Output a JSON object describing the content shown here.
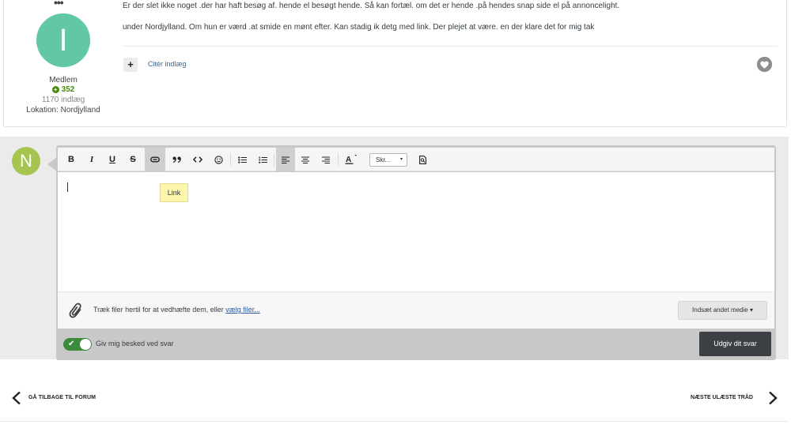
{
  "post": {
    "author": {
      "avatar_letter": "I",
      "avatar_color": "#62c7a5",
      "role": "Medlem",
      "reputation": "352",
      "post_count": "1170 indlæg",
      "location": "Lokation: Nordjylland"
    },
    "paragraph_1": "Er der slet ikke noget .der har haft besøg af. hende el besøgt hende. Så kan fortæl. om det er hende .på hendes snap side el på annoncelight.",
    "paragraph_2": "under Nordjylland. Om hun er værd .at smide en mønt efter. Kan stadig ik detg med link. Der plejet at være. en der klare det for mig tak",
    "quote_button_label": "+",
    "quote_link": "Citér indlæg",
    "like_icon": "heart-icon"
  },
  "reply": {
    "avatar_letter": "N",
    "avatar_color": "#a6c44f",
    "toolbar": {
      "bold": "B",
      "italic": "I",
      "underline": "U",
      "strike": "S",
      "font_select": "Skr...",
      "font_select_caret": "▾"
    },
    "tooltip": "Link",
    "attach_text": "Træk filer hertil for at vedhæfte dem, eller",
    "attach_link": "vælg filer...",
    "media_button": "Indsæt andet medie ▾",
    "notify_check": "✔",
    "notify_label": "Giv mig besked ved svar",
    "publish_button": "Udgiv dit svar"
  },
  "nav": {
    "back_label": "GÅ TILBAGE TIL FORUM",
    "next_label": "NÆSTE ULÆSTE TRÅD"
  },
  "colors": {
    "accent_green": "#478a0a",
    "link_blue": "#3d6594",
    "publish_bg": "#3c3f44"
  }
}
